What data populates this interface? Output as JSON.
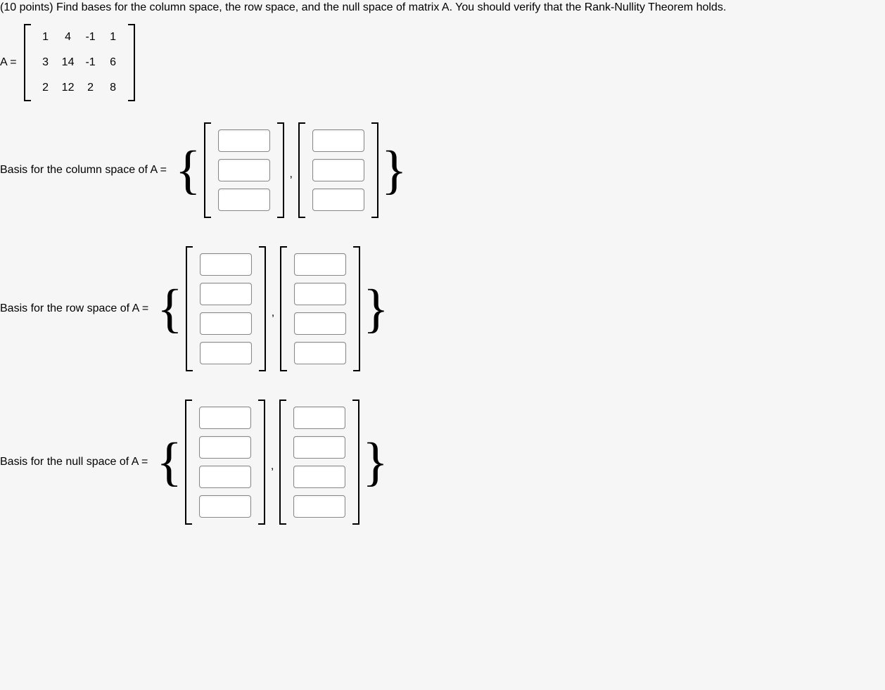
{
  "problem": {
    "text": "(10 points) Find bases for the column space, the row space, and the null space of matrix A. You should verify that the Rank-Nullity Theorem holds."
  },
  "matrix": {
    "name": "A =",
    "rows": [
      [
        "1",
        "4",
        "-1",
        "1"
      ],
      [
        "3",
        "14",
        "-1",
        "6"
      ],
      [
        "2",
        "12",
        "2",
        "8"
      ]
    ]
  },
  "sections": {
    "col": {
      "label": "Basis for the column space of A =",
      "vectors": [
        {
          "size": 3,
          "values": [
            "",
            "",
            ""
          ]
        },
        {
          "size": 3,
          "values": [
            "",
            "",
            ""
          ]
        }
      ]
    },
    "row": {
      "label": "Basis for the row space of A =",
      "vectors": [
        {
          "size": 4,
          "values": [
            "",
            "",
            "",
            ""
          ]
        },
        {
          "size": 4,
          "values": [
            "",
            "",
            "",
            ""
          ]
        }
      ]
    },
    "null": {
      "label": "Basis for the null space of A =",
      "vectors": [
        {
          "size": 4,
          "values": [
            "",
            "",
            "",
            ""
          ]
        },
        {
          "size": 4,
          "values": [
            "",
            "",
            "",
            ""
          ]
        }
      ]
    }
  },
  "symbols": {
    "open_brace": "{",
    "close_brace": "}",
    "comma": ","
  }
}
